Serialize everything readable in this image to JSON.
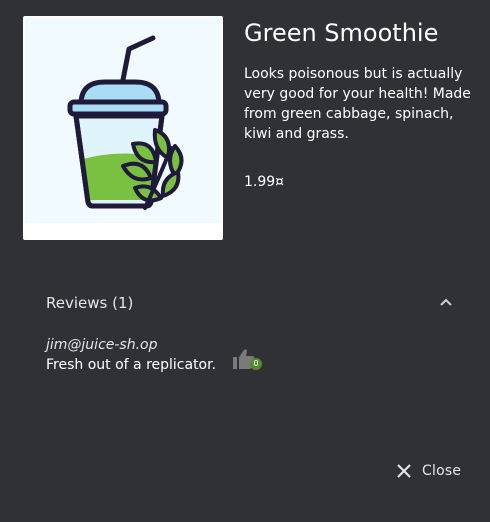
{
  "product": {
    "name": "Green Smoothie",
    "description": "Looks poisonous but is actually very good for your health! Made from green cabbage, spinach, kiwi and grass.",
    "price": "1.99¤",
    "image_icon": "smoothie-cup-icon"
  },
  "reviews": {
    "title": "Reviews (1)",
    "expanded": true,
    "items": [
      {
        "author": "jim@juice-sh.op",
        "message": "Fresh out of a replicator.",
        "likes": "0"
      }
    ]
  },
  "actions": {
    "close_label": "Close"
  },
  "colors": {
    "dialog_background": "#2f3134",
    "like_badge": "#558b2f",
    "smoothie_green": "#7ac142",
    "cup_outline": "#1f1a3a"
  }
}
